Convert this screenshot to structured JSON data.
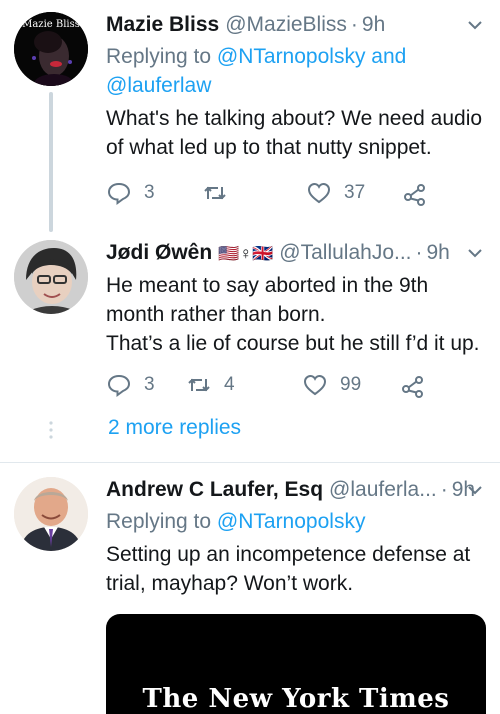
{
  "tweets": [
    {
      "name": "Mazie Bliss",
      "handle": "@MazieBliss",
      "time": "9h",
      "replying_prefix": "Replying to",
      "replying_1": "@NTarnopolsky",
      "replying_and": "and",
      "replying_2": "@lauferlaw",
      "avatar_text": "Mazie Bliss",
      "lines": [
        "What's he talking about? We need audio",
        "of what led up to that nutty snippet."
      ],
      "replies": "3",
      "retweets": "",
      "likes": "37"
    },
    {
      "name": "Jødi Øwên",
      "flags": "🇺🇸♀🇬🇧",
      "handle": "@TallulahJo...",
      "time": "9h",
      "lines": [
        "He meant to say aborted in the 9th",
        "month rather than born.",
        "That’s a lie of course but he still f’d it up."
      ],
      "replies": "3",
      "retweets": "4",
      "likes": "99",
      "more_replies": "2 more replies"
    },
    {
      "name": "Andrew C Laufer, Esq",
      "handle": "@lauferla...",
      "time": "9h",
      "replying_prefix": "Replying to",
      "replying_1": "@NTarnopolsky",
      "lines": [
        "Setting up an incompetence defense at",
        "trial, mayhap?  Won’t work."
      ],
      "card_brand": "The New York Times"
    }
  ],
  "colors": {
    "accent": "#1da1f2",
    "muted": "#657786",
    "text": "#14171a",
    "divider": "#e1e8ed"
  }
}
